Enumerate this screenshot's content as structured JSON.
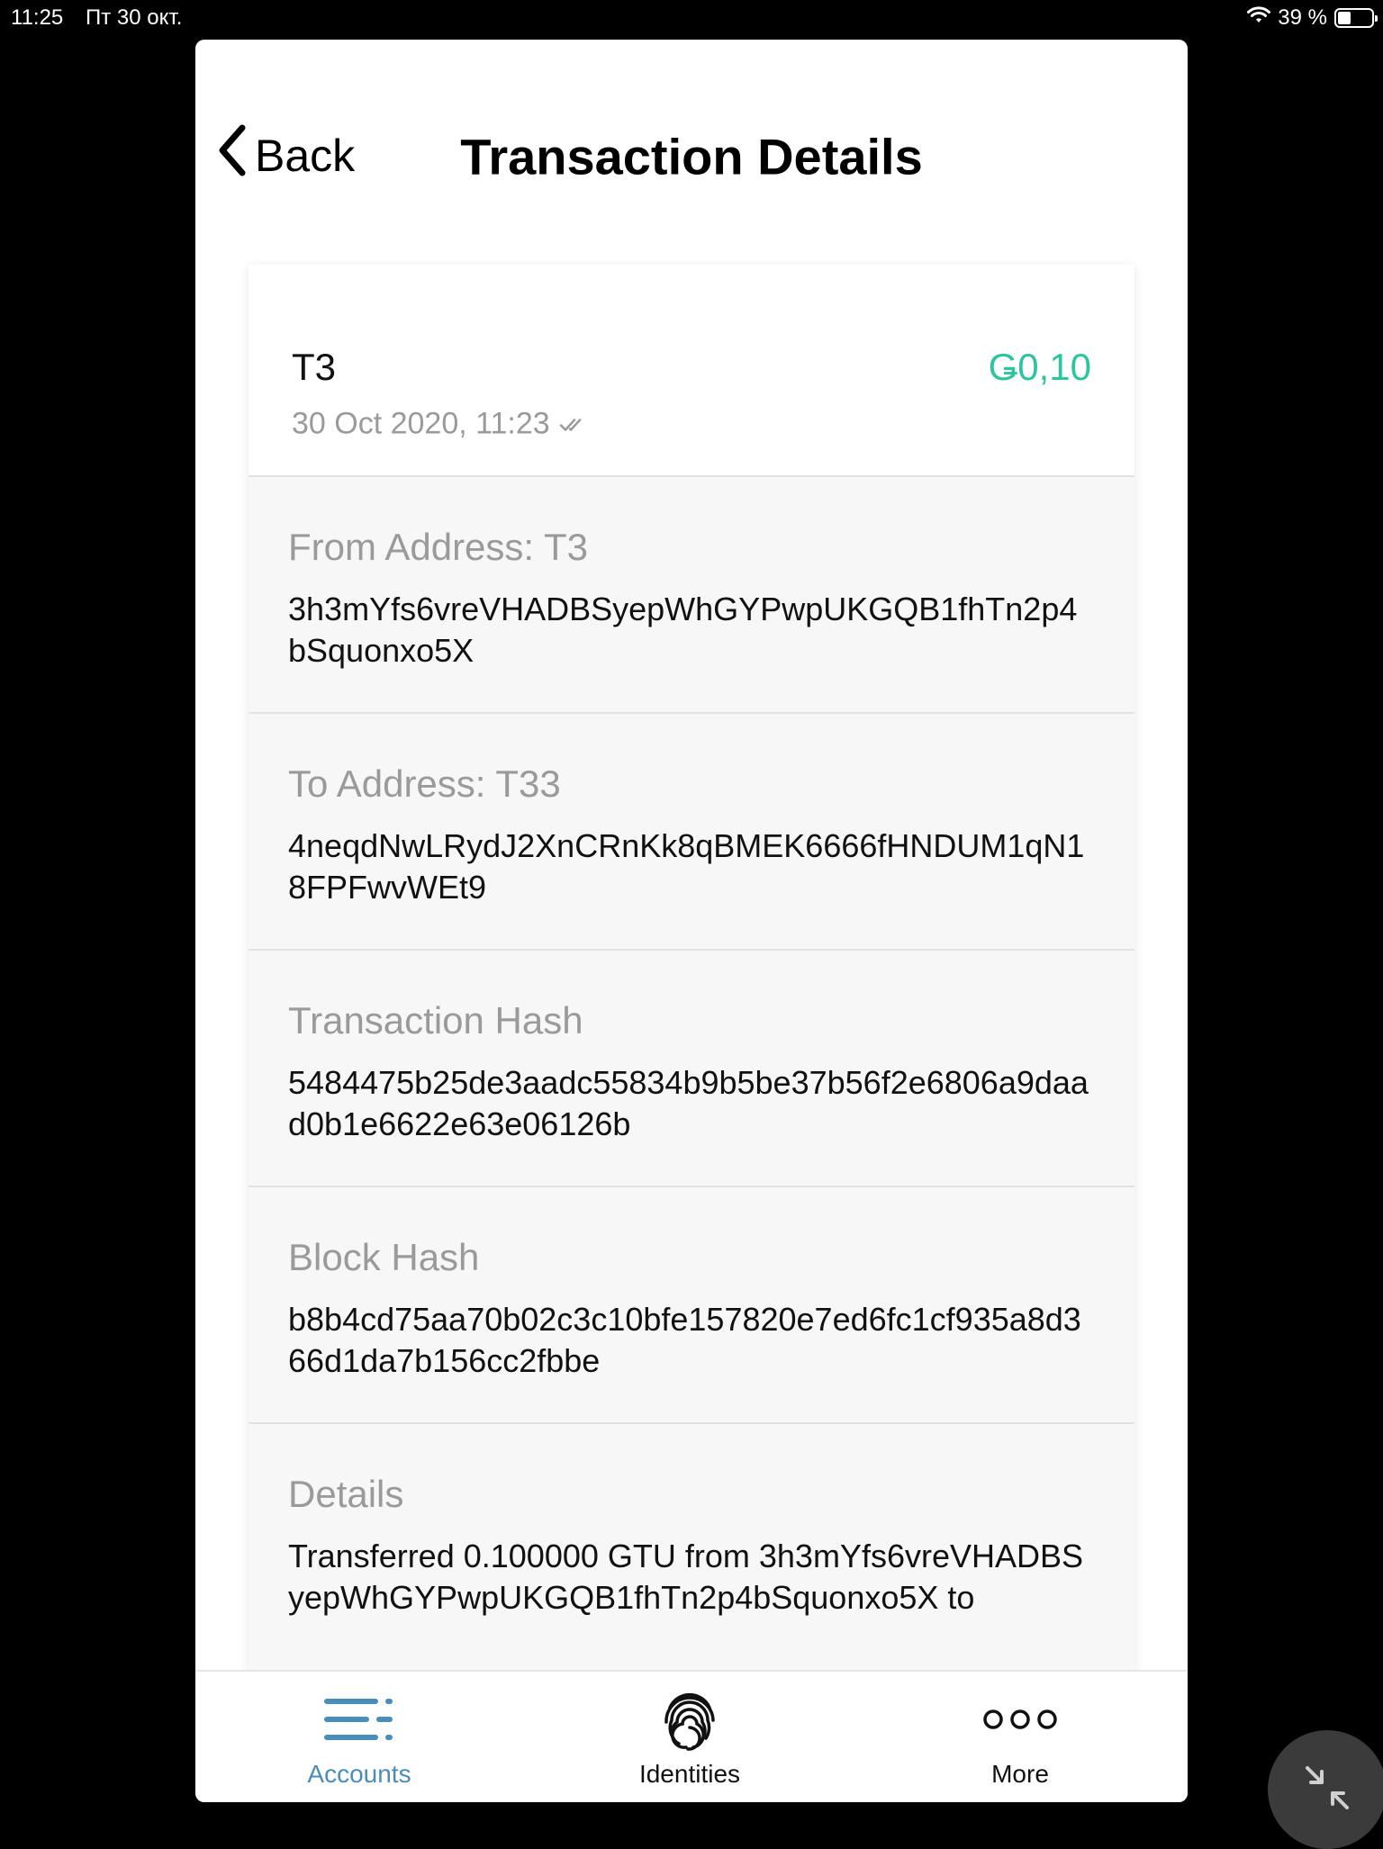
{
  "status_bar": {
    "time": "11:25",
    "date": "Пт 30 окт.",
    "battery_percent": "39 %",
    "battery_level": 0.39
  },
  "nav": {
    "back_label": "Back",
    "title": "Transaction Details"
  },
  "transaction": {
    "name": "T3",
    "date": "30 Oct 2020, 11:23",
    "amount": "Ǥ0,10"
  },
  "sections": {
    "from_label": "From Address: T3",
    "from_value": "3h3mYfs6vreVHADBSyepWhGYPwpUKGQB1fhTn2p4bSquonxo5X",
    "to_label": "To Address: T33",
    "to_value": "4neqdNwLRydJ2XnCRnKk8qBMEK6666fHNDUM1qN18FPFwvWEt9",
    "tx_hash_label": "Transaction Hash",
    "tx_hash_value": "5484475b25de3aadc55834b9b5be37b56f2e6806a9daad0b1e6622e63e06126b",
    "block_hash_label": "Block Hash",
    "block_hash_value": "b8b4cd75aa70b02c3c10bfe157820e7ed6fc1cf935a8d366d1da7b156cc2fbbe",
    "details_label": "Details",
    "details_value": "Transferred 0.100000 GTU from 3h3mYfs6vreVHADBSyepWhGYPwpUKGQB1fhTn2p4bSquonxo5X to"
  },
  "tabs": {
    "accounts": "Accounts",
    "identities": "Identities",
    "more": "More"
  },
  "colors": {
    "amount": "#2ec4a0",
    "active_tab": "#4a8db8"
  }
}
